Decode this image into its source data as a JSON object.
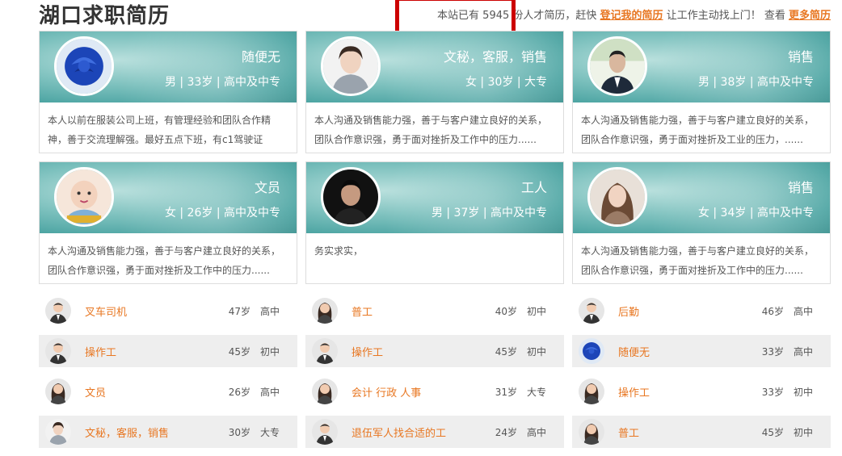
{
  "header": {
    "title": "湖口求职简历",
    "stat_prefix": "本站已有 5945 份人才简历，赶快",
    "register_link": "登记我的简历",
    "stat_middle": "让工作主动找上门！ 查看",
    "more_link": "更多简历"
  },
  "cards": [
    {
      "job": "随便无",
      "meta": "男 | 33岁 | 高中及中专",
      "desc": "本人以前在服装公司上班，有管理经验和团队合作精神，善于交流理解强。最好五点下班，有c1驾驶证",
      "avatar": "rose-avatar"
    },
    {
      "job": "文秘，客服，销售",
      "meta": "女 | 30岁 | 大专",
      "desc": "本人沟通及销售能力强，善于与客户建立良好的关系，团队合作意识强，勇于面对挫折及工作中的压力......",
      "avatar": "woman-avatar"
    },
    {
      "job": "销售",
      "meta": "男 | 38岁 | 高中及中专",
      "desc": "本人沟通及销售能力强，善于与客户建立良好的关系，团队合作意识强，勇于面对挫折及工业的压力，......",
      "avatar": "man-avatar"
    },
    {
      "job": "文员",
      "meta": "女 | 26岁 | 高中及中专",
      "desc": "本人沟通及销售能力强，善于与客户建立良好的关系，团队合作意识强，勇于面对挫折及工作中的压力......",
      "avatar": "baby-avatar"
    },
    {
      "job": "工人",
      "meta": "男 | 37岁 | 高中及中专",
      "desc": "务实求实，",
      "avatar": "dark-man-avatar"
    },
    {
      "job": "销售",
      "meta": "女 | 34岁 | 高中及中专",
      "desc": "本人沟通及销售能力强，善于与客户建立良好的关系，团队合作意识强，勇于面对挫折及工作中的压力......",
      "avatar": "woman2-avatar"
    }
  ],
  "list": [
    {
      "job": "叉车司机",
      "age": "47岁",
      "edu": "高中",
      "icon": "male-avatar-icon"
    },
    {
      "job": "普工",
      "age": "40岁",
      "edu": "初中",
      "icon": "female-avatar-icon"
    },
    {
      "job": "后勤",
      "age": "46岁",
      "edu": "高中",
      "icon": "male-avatar-icon"
    },
    {
      "job": "操作工",
      "age": "45岁",
      "edu": "初中",
      "icon": "male-avatar-icon"
    },
    {
      "job": "操作工",
      "age": "45岁",
      "edu": "初中",
      "icon": "male-avatar-icon"
    },
    {
      "job": "随便无",
      "age": "33岁",
      "edu": "高中",
      "icon": "rose-avatar-icon"
    },
    {
      "job": "文员",
      "age": "26岁",
      "edu": "高中",
      "icon": "female-avatar-icon"
    },
    {
      "job": "会计 行政 人事",
      "age": "31岁",
      "edu": "大专",
      "icon": "female-avatar-icon"
    },
    {
      "job": "操作工",
      "age": "33岁",
      "edu": "初中",
      "icon": "female-avatar-icon"
    },
    {
      "job": "文秘，客服，销售",
      "age": "30岁",
      "edu": "大专",
      "icon": "photo-avatar-icon"
    },
    {
      "job": "退伍军人找合适的工",
      "age": "24岁",
      "edu": "高中",
      "icon": "male-avatar-icon"
    },
    {
      "job": "普工",
      "age": "45岁",
      "edu": "初中",
      "icon": "female-avatar-icon"
    }
  ],
  "colors": {
    "accent": "#e87722",
    "highlight": "#cc0000",
    "card_bg": "#5aadaa"
  }
}
